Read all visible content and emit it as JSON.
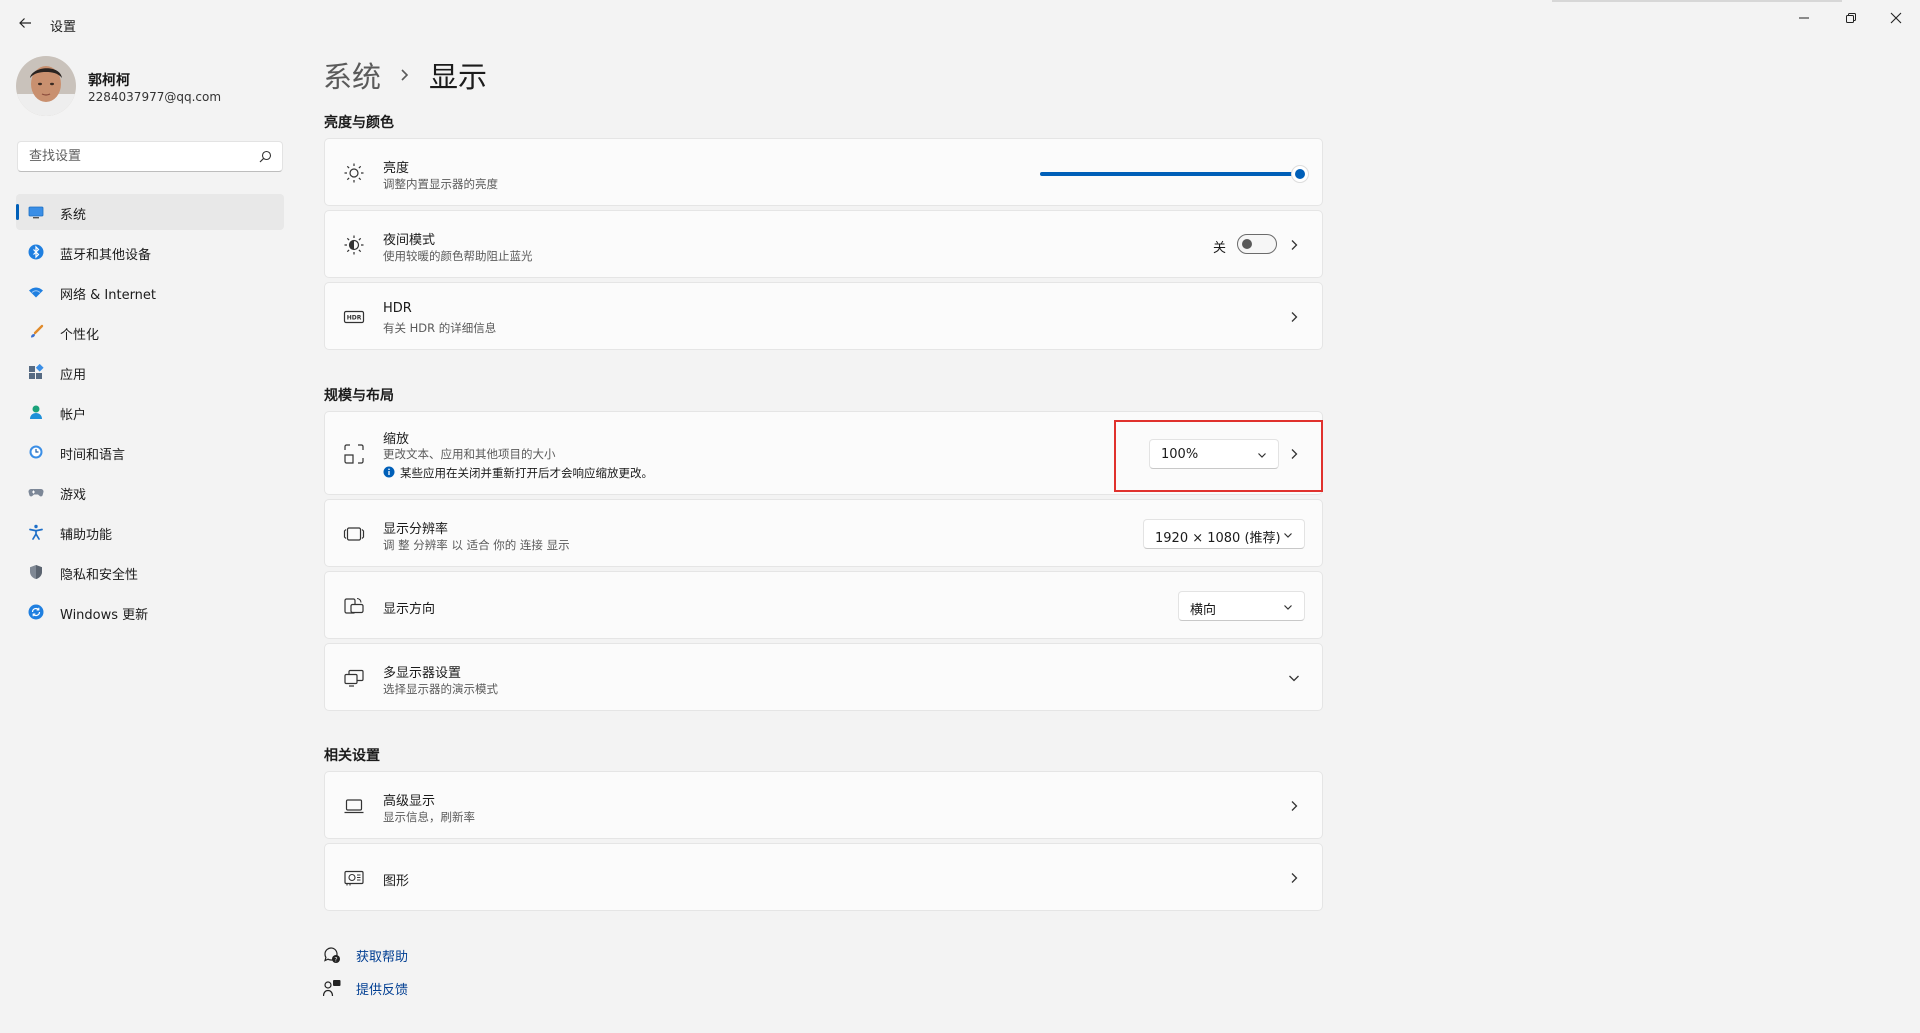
{
  "app": {
    "title": "设置"
  },
  "user": {
    "name": "郭柯柯",
    "email": "2284037977@qq.com"
  },
  "search": {
    "placeholder": "查找设置"
  },
  "nav": {
    "items": [
      {
        "label": "系统",
        "icon": "system-icon",
        "active": true
      },
      {
        "label": "蓝牙和其他设备",
        "icon": "bluetooth-icon"
      },
      {
        "label": "网络 & Internet",
        "icon": "wifi-icon"
      },
      {
        "label": "个性化",
        "icon": "brush-icon"
      },
      {
        "label": "应用",
        "icon": "apps-icon"
      },
      {
        "label": "帐户",
        "icon": "person-icon"
      },
      {
        "label": "时间和语言",
        "icon": "globe-clock-icon"
      },
      {
        "label": "游戏",
        "icon": "gamepad-icon"
      },
      {
        "label": "辅助功能",
        "icon": "accessibility-icon"
      },
      {
        "label": "隐私和安全性",
        "icon": "shield-icon"
      },
      {
        "label": "Windows 更新",
        "icon": "update-icon"
      }
    ]
  },
  "breadcrumb": {
    "parent": "系统",
    "current": "显示"
  },
  "sections": {
    "brightness_color": {
      "title": "亮度与颜色",
      "brightness": {
        "title": "亮度",
        "subtitle": "调整内置显示器的亮度",
        "value": 100
      },
      "night_mode": {
        "title": "夜间模式",
        "subtitle": "使用较暖的颜色帮助阻止蓝光",
        "state_label": "关",
        "on": false
      },
      "hdr": {
        "title": "HDR",
        "link": "有关 HDR 的详细信息"
      }
    },
    "scale_layout": {
      "title": "规模与布局",
      "scale": {
        "title": "缩放",
        "subtitle": "更改文本、应用和其他项目的大小",
        "note": "某些应用在关闭并重新打开后才会响应缩放更改。",
        "value": "100%"
      },
      "resolution": {
        "title": "显示分辨率",
        "subtitle": "调 整 分辨率 以 适合 你的 连接 显示",
        "value": "1920 × 1080 (推荐)"
      },
      "orientation": {
        "title": "显示方向",
        "value": "横向"
      },
      "multi_display": {
        "title": "多显示器设置",
        "subtitle": "选择显示器的演示模式"
      }
    },
    "related": {
      "title": "相关设置",
      "advanced": {
        "title": "高级显示",
        "subtitle": "显示信息，刷新率"
      },
      "graphics": {
        "title": "图形"
      }
    }
  },
  "footer": {
    "help": "获取帮助",
    "feedback": "提供反馈"
  },
  "colors": {
    "accent": "#005fb8",
    "highlight_border": "#e0312d",
    "background": "#f3f3f3",
    "card": "#fbfbfb"
  }
}
